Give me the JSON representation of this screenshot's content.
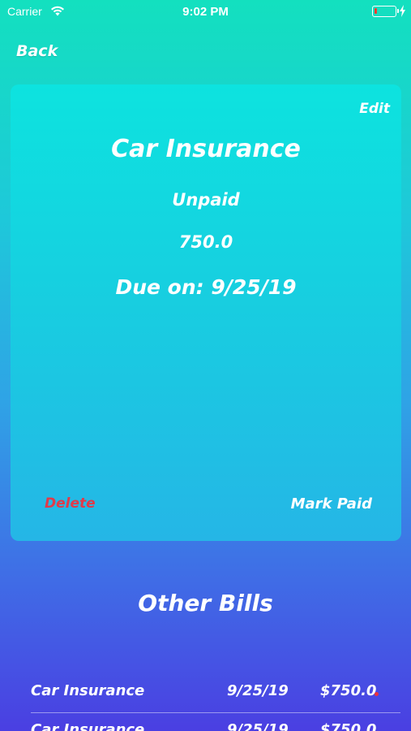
{
  "status_bar": {
    "carrier": "Carrier",
    "time": "9:02 PM"
  },
  "nav": {
    "back_label": "Back"
  },
  "bill_detail": {
    "edit_label": "Edit",
    "title": "Car Insurance",
    "status": "Unpaid",
    "amount": "750.0",
    "due": "Due on: 9/25/19",
    "delete_label": "Delete",
    "mark_paid_label": "Mark Paid"
  },
  "other_bills": {
    "title": "Other Bills",
    "rows": [
      {
        "name": "Car Insurance",
        "date": "9/25/19",
        "amount": "$750.0",
        "unpaid_marker": true
      },
      {
        "name": "Car Insurance",
        "date": "9/25/19",
        "amount": "$750.0",
        "unpaid_marker": false
      }
    ]
  },
  "colors": {
    "gradient_top": "#13e0bf",
    "gradient_bottom": "#4a3fe2",
    "card": "#17cfe0",
    "delete": "#e03b4a",
    "unpaid_dot": "#e8333f"
  }
}
